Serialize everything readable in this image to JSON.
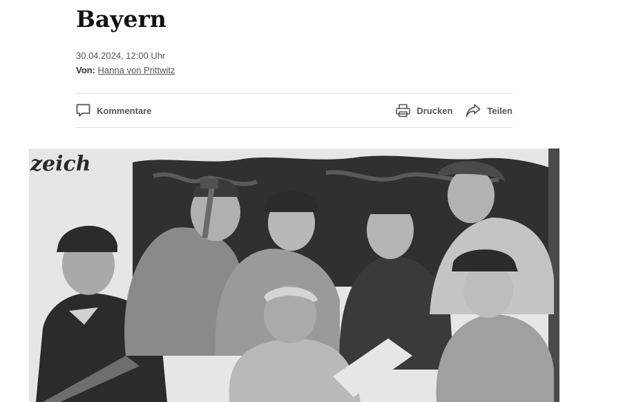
{
  "article": {
    "headline": "Bayern",
    "date": "30.04.2024, 12:00 Uhr",
    "byline_prefix": "Von:",
    "author": "Hanna von Prittwitz"
  },
  "toolbar": {
    "comments_label": "Kommentare",
    "print_label": "Drucken",
    "share_label": "Teilen",
    "icons": {
      "comments": "comment-icon",
      "print": "printer-icon",
      "share": "share-arrow-icon"
    },
    "icon_color": "#555555"
  },
  "photo": {
    "sign_text": "zeich",
    "colors": {
      "sky": "#e6e6e6",
      "foliage": "#303030",
      "clothing_dark": "#2b2b2b",
      "clothing_light": "#b9b9b9",
      "skin": "#a9a9a9"
    }
  }
}
